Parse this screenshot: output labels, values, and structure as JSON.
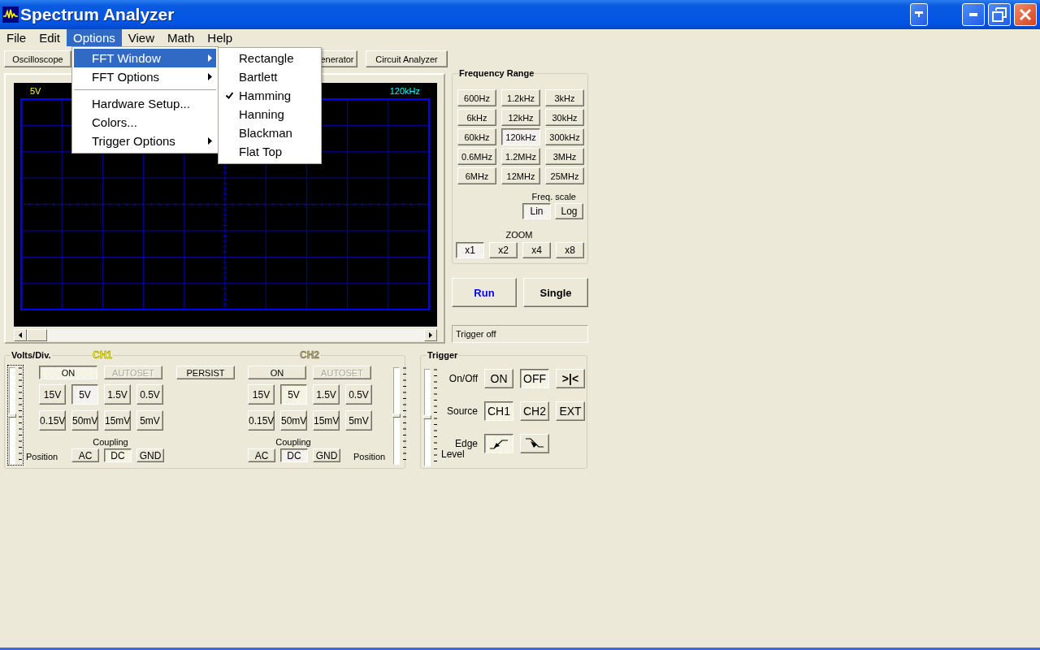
{
  "window": {
    "title": "Spectrum Analyzer"
  },
  "menu_bar": [
    {
      "label": "File",
      "selected": false
    },
    {
      "label": "Edit",
      "selected": false
    },
    {
      "label": "Options",
      "selected": true
    },
    {
      "label": "View",
      "selected": false
    },
    {
      "label": "Math",
      "selected": false
    },
    {
      "label": "Help",
      "selected": false
    }
  ],
  "toolbar": [
    {
      "label": "Oscilloscope"
    },
    {
      "label": "enerator"
    },
    {
      "label": "Circuit Analyzer"
    }
  ],
  "options_menu": [
    {
      "kind": "item",
      "label": "FFT Window",
      "submenu": true,
      "selected": true
    },
    {
      "kind": "item",
      "label": "FFT Options",
      "submenu": true,
      "selected": false
    },
    {
      "kind": "separator"
    },
    {
      "kind": "item",
      "label": "Hardware Setup...",
      "submenu": false,
      "selected": false
    },
    {
      "kind": "item",
      "label": "Colors...",
      "submenu": false,
      "selected": false
    },
    {
      "kind": "item",
      "label": "Trigger Options",
      "submenu": true,
      "selected": false
    }
  ],
  "fft_window_menu": [
    {
      "label": "Rectangle",
      "checked": false
    },
    {
      "label": "Bartlett",
      "checked": false
    },
    {
      "label": "Hamming",
      "checked": true
    },
    {
      "label": "Hanning",
      "checked": false
    },
    {
      "label": "Blackman",
      "checked": false
    },
    {
      "label": "Flat Top",
      "checked": false
    }
  ],
  "scope": {
    "volts_label": "5V",
    "frequency_label": "120kHz"
  },
  "frequency_range": {
    "title": "Frequency Range",
    "buttons": [
      {
        "label": "600Hz",
        "selected": false
      },
      {
        "label": "1.2kHz",
        "selected": false
      },
      {
        "label": "3kHz",
        "selected": false
      },
      {
        "label": "6kHz",
        "selected": false
      },
      {
        "label": "12kHz",
        "selected": false
      },
      {
        "label": "30kHz",
        "selected": false
      },
      {
        "label": "60kHz",
        "selected": false
      },
      {
        "label": "120kHz",
        "selected": true
      },
      {
        "label": "300kHz",
        "selected": false
      },
      {
        "label": "0.6MHz",
        "selected": false
      },
      {
        "label": "1.2MHz",
        "selected": false
      },
      {
        "label": "3MHz",
        "selected": false
      },
      {
        "label": "6MHz",
        "selected": false
      },
      {
        "label": "12MHz",
        "selected": false
      },
      {
        "label": "25MHz",
        "selected": false
      }
    ],
    "scale_label": "Freq. scale",
    "scale": [
      {
        "label": "Lin",
        "selected": true
      },
      {
        "label": "Log",
        "selected": false
      }
    ],
    "zoom_label": "ZOOM",
    "zoom": [
      {
        "label": "x1",
        "selected": true
      },
      {
        "label": "x2",
        "selected": false
      },
      {
        "label": "x4",
        "selected": false
      },
      {
        "label": "x8",
        "selected": false
      }
    ]
  },
  "run_button": {
    "label": "Run"
  },
  "single_button": {
    "label": "Single"
  },
  "status": "Trigger off",
  "volts_div": {
    "title": "Volts/Div.",
    "persist": {
      "label": "PERSIST"
    },
    "channels": [
      {
        "name": "CH1",
        "color": "#ffff00",
        "power": {
          "label": "ON",
          "selected": true
        },
        "autoset": {
          "label": "AUTOSET",
          "disabled": true
        },
        "ranges": [
          {
            "label": "15V",
            "selected": false
          },
          {
            "label": "5V",
            "selected": true
          },
          {
            "label": "1.5V",
            "selected": false
          },
          {
            "label": "0.5V",
            "selected": false
          },
          {
            "label": "0.15V",
            "selected": false
          },
          {
            "label": "50mV",
            "selected": false
          },
          {
            "label": "15mV",
            "selected": false
          },
          {
            "label": "5mV",
            "selected": false
          }
        ],
        "coupling_label": "Coupling",
        "coupling": [
          {
            "label": "AC",
            "selected": false
          },
          {
            "label": "DC",
            "selected": true
          },
          {
            "label": "GND",
            "selected": false
          }
        ],
        "position_label": "Position",
        "position": {
          "level": 0.5
        }
      },
      {
        "name": "CH2",
        "color": "#a0a0a0",
        "power": {
          "label": "ON",
          "selected": false
        },
        "autoset": {
          "label": "AUTOSET",
          "disabled": true
        },
        "ranges": [
          {
            "label": "15V",
            "selected": false
          },
          {
            "label": "5V",
            "selected": true
          },
          {
            "label": "1.5V",
            "selected": false
          },
          {
            "label": "0.5V",
            "selected": false
          },
          {
            "label": "0.15V",
            "selected": false
          },
          {
            "label": "50mV",
            "selected": false
          },
          {
            "label": "15mV",
            "selected": false
          },
          {
            "label": "5mV",
            "selected": false
          }
        ],
        "coupling_label": "Coupling",
        "coupling": [
          {
            "label": "AC",
            "selected": false
          },
          {
            "label": "DC",
            "selected": true
          },
          {
            "label": "GND",
            "selected": false
          }
        ],
        "position_label": "Position",
        "position": {
          "level": 0.5
        }
      }
    ]
  },
  "trigger": {
    "title": "Trigger",
    "level_label": "Level",
    "level": 0.5,
    "rows": [
      {
        "label": "On/Off",
        "buttons": [
          {
            "kind": "text",
            "label": "ON",
            "selected": false
          },
          {
            "kind": "text",
            "label": "OFF",
            "selected": true
          },
          {
            "kind": "symbol",
            "label": ">|<",
            "selected": false
          }
        ]
      },
      {
        "label": "Source",
        "buttons": [
          {
            "kind": "text",
            "label": "CH1",
            "selected": true
          },
          {
            "kind": "text",
            "label": "CH2",
            "selected": false
          },
          {
            "kind": "text",
            "label": "EXT",
            "selected": false
          }
        ]
      },
      {
        "label": "Edge",
        "buttons": [
          {
            "kind": "rising_edge",
            "selected": true
          },
          {
            "kind": "falling_edge",
            "selected": false
          }
        ]
      }
    ]
  }
}
